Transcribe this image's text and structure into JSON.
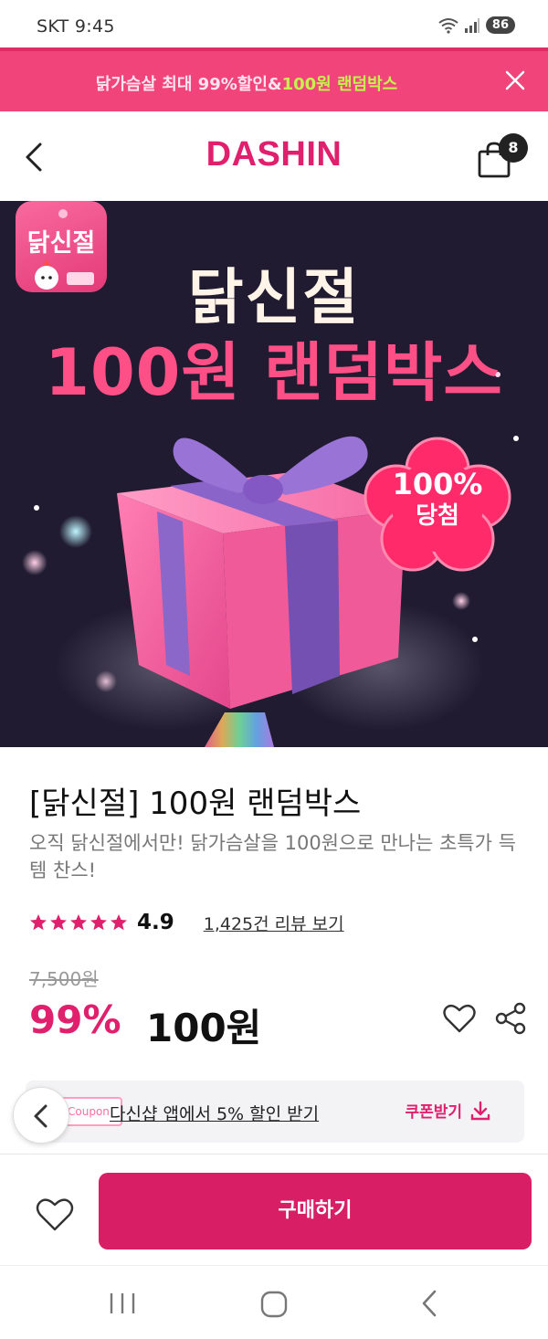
{
  "status_bar": {
    "carrier_time": "SKT 9:45",
    "battery": "86"
  },
  "promo_banner": {
    "text_main": "닭가슴살 최대 99%할인&",
    "text_highlight": "100원 랜덤박스"
  },
  "header": {
    "logo": "DASHIN",
    "cart_count": "8"
  },
  "hero": {
    "app_icon_label": "닭신절",
    "title_line1": "닭신절",
    "title_line2": "100원 랜덤박스",
    "burst_line1": "100%",
    "burst_line2": "당첨"
  },
  "product": {
    "title": "[닭신절] 100원 랜덤박스",
    "description": "오직 닭신절에서만! 닭가슴살을 100원으로 만나는 초특가 득템 찬스!",
    "rating": "4.9",
    "stars": 5,
    "review_link": "1,425건 리뷰 보기",
    "original_price": "7,500원",
    "discount": "99%",
    "sale_price": "100원"
  },
  "coupon": {
    "tag": "Coupon",
    "label": "다신샵 앱에서 5% 할인 받기",
    "action": "쿠폰받기"
  },
  "buy_bar": {
    "buy_label": "구매하기"
  },
  "colors": {
    "brand": "#e0206d",
    "promo": "#f0447b",
    "hero_bg": "#201b31"
  }
}
